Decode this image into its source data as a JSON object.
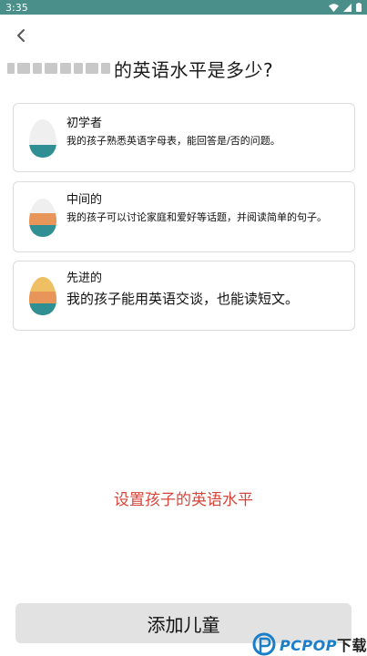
{
  "status_bar": {
    "time": "3:35",
    "icons": [
      "wifi-icon",
      "signal-icon",
      "battery-icon"
    ]
  },
  "header": {
    "back_icon": "chevron-left-icon",
    "title": "的英语水平是多少?"
  },
  "levels": [
    {
      "title": "初学者",
      "description": "我的孩子熟悉英语字母表，能回答是/否的问题。",
      "fill": "one-third"
    },
    {
      "title": "中间的",
      "description": "我的孩子可以讨论家庭和爱好等话题，并阅读简单的句子。",
      "fill": "two-thirds"
    },
    {
      "title": "先进的",
      "description": "我的孩子能用英语交谈，也能读短文。",
      "fill": "full"
    }
  ],
  "set_level_link": "设置孩子的英语水平",
  "add_child_button": "添加儿童",
  "watermark": {
    "brand": "PCPOP",
    "suffix": "下载"
  },
  "colors": {
    "status_bar": "#4a8f89",
    "egg_teal": "#2f8f92",
    "egg_orange": "#e8955a",
    "egg_yellow": "#efbf63",
    "link_red": "#d6453a",
    "button_bg": "#e2e2e2"
  }
}
